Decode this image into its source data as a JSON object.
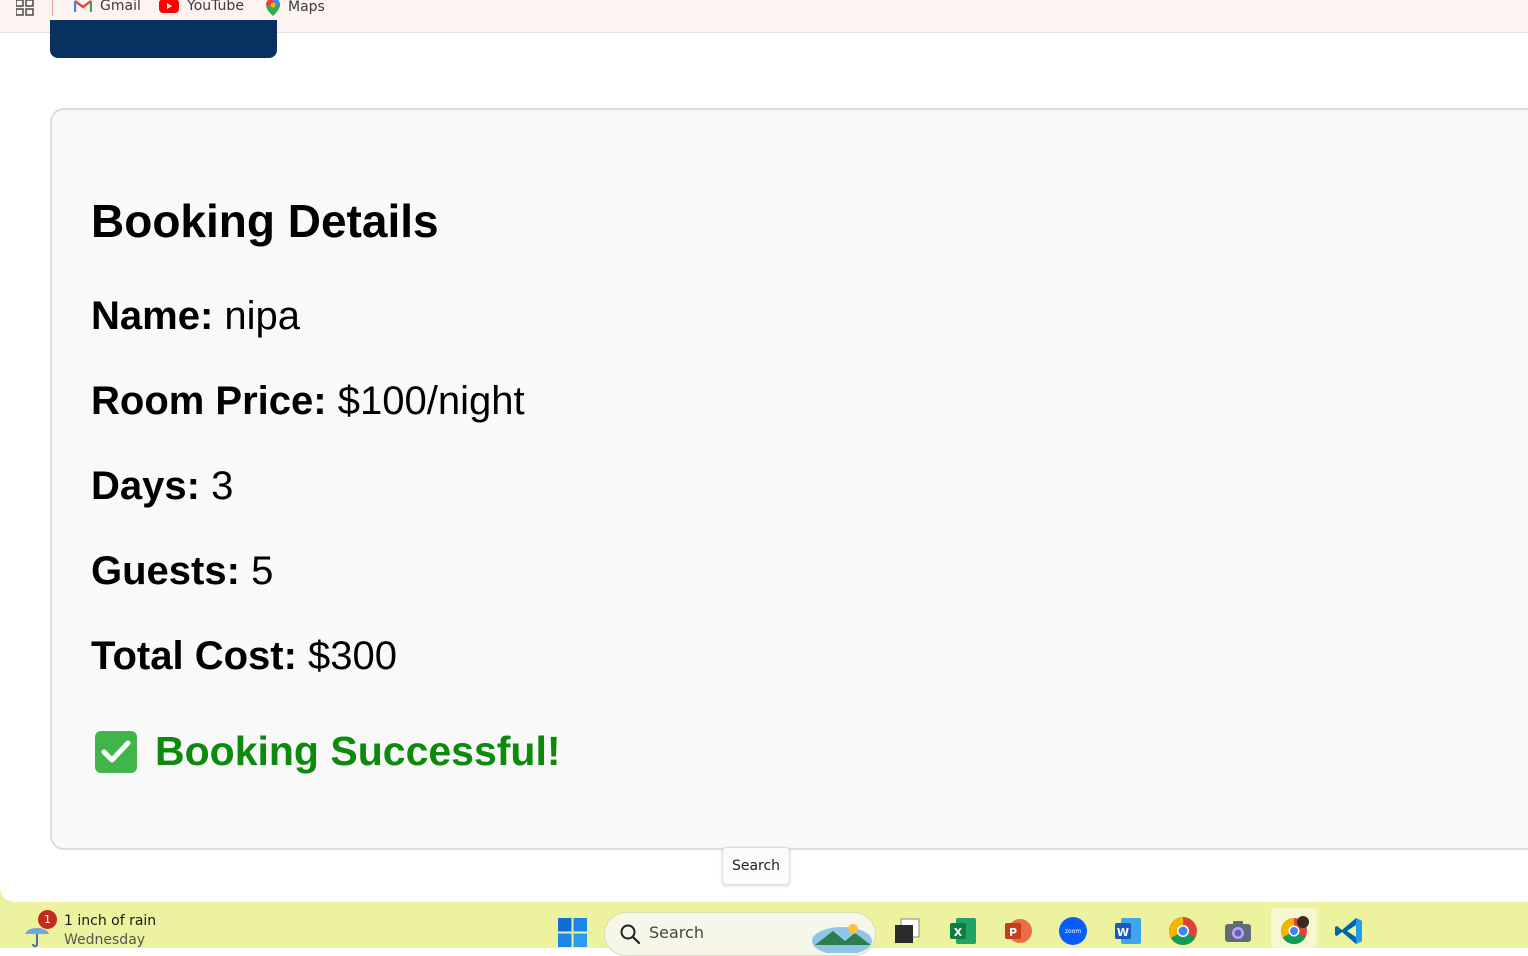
{
  "bookmarks": {
    "items": [
      {
        "label": "Gmail"
      },
      {
        "label": "YouTube"
      },
      {
        "label": "Maps"
      }
    ]
  },
  "booking": {
    "title": "Booking Details",
    "name_label": "Name:",
    "name_value": "nipa",
    "price_label": "Room Price:",
    "price_value": "$100/night",
    "days_label": "Days:",
    "days_value": "3",
    "guests_label": "Guests:",
    "guests_value": "5",
    "total_label": "Total Cost:",
    "total_value": "$300",
    "success_message": "Booking Successful!",
    "success_color": "#0b8a0b"
  },
  "tooltip": {
    "text": "Search"
  },
  "taskbar": {
    "weather_badge": "1",
    "weather_line1": "1 inch of rain",
    "weather_line2": "Wednesday",
    "search_placeholder": "Search",
    "apps": [
      "windows-start",
      "file-explorer",
      "excel",
      "powerpoint",
      "zoom",
      "word",
      "chrome",
      "camera",
      "chrome-profile",
      "vscode"
    ]
  },
  "colors": {
    "nav_button": "#08315f",
    "taskbar_bg": "#ecf29e",
    "card_bg": "#f9f9f9"
  }
}
